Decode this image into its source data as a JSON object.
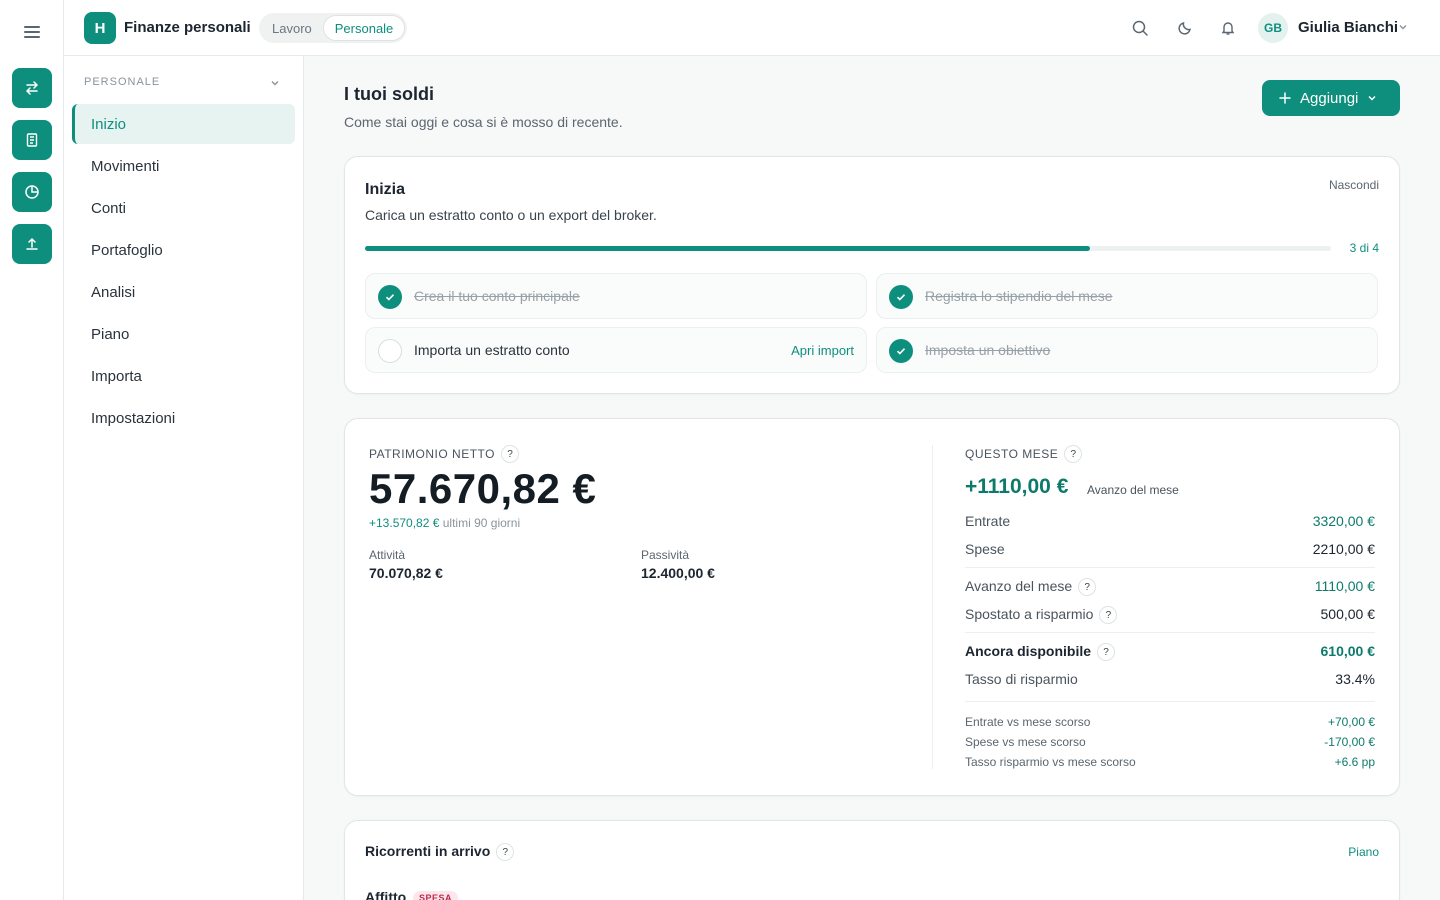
{
  "topbar": {
    "logo_letter": "H",
    "app_name": "Finanze personali",
    "segments": [
      "Lavoro",
      "Personale"
    ],
    "user_initials": "GB",
    "user_name": "Giulia Bianchi"
  },
  "sidebar": {
    "section": "PERSONALE",
    "items": [
      {
        "label": "Inizio",
        "active": true
      },
      {
        "label": "Movimenti"
      },
      {
        "label": "Conti"
      },
      {
        "label": "Portafoglio"
      },
      {
        "label": "Analisi"
      },
      {
        "label": "Piano"
      },
      {
        "label": "Importa"
      },
      {
        "label": "Impostazioni"
      }
    ]
  },
  "page": {
    "title": "I tuoi soldi",
    "subtitle": "Come stai oggi e cosa si è mosso di recente.",
    "add_label": "Aggiungi"
  },
  "onboarding": {
    "title": "Inizia",
    "description": "Carica un estratto conto o un export del broker.",
    "hide_label": "Nascondi",
    "progress_label": "3 di 4",
    "progress_fraction": 0.75,
    "tasks": [
      {
        "label": "Crea il tuo conto principale",
        "done": true
      },
      {
        "label": "Registra lo stipendio del mese",
        "done": true
      },
      {
        "label": "Importa un estratto conto",
        "done": false,
        "action": "Apri import"
      },
      {
        "label": "Imposta un obiettivo",
        "done": true
      }
    ]
  },
  "net_worth": {
    "caption": "PATRIMONIO NETTO",
    "help": "?",
    "value": "57.670,82 €",
    "delta": "+13.570,82 €",
    "delta_period": "ultimi 90 giorni",
    "assets_label": "Attività",
    "assets_value": "70.070,82 €",
    "liabilities_label": "Passività",
    "liabilities_value": "12.400,00 €"
  },
  "month": {
    "caption": "QUESTO MESE",
    "help": "?",
    "surplus": "+1110,00 €",
    "surplus_label": "Avanzo del mese",
    "income_label": "Entrate",
    "income_value": "3320,00 €",
    "expenses_label": "Spese",
    "expenses_value": "2210,00 €",
    "surplus_row_label": "Avanzo del mese",
    "surplus_row_value": "1110,00 €",
    "savings_moved_label": "Spostato a risparmio",
    "savings_moved_value": "500,00 €",
    "available_label": "Ancora disponibile",
    "available_value": "610,00 €",
    "savings_rate_label": "Tasso di risparmio",
    "savings_rate_value": "33.4%",
    "cmp_income_label": "Entrate vs mese scorso",
    "cmp_income_value": "+70,00 €",
    "cmp_expenses_label": "Spese vs mese scorso",
    "cmp_expenses_value": "-170,00 €",
    "cmp_rate_label": "Tasso risparmio vs mese scorso",
    "cmp_rate_value": "+6.6 pp"
  },
  "recurring": {
    "title": "Ricorrenti in arrivo",
    "help": "?",
    "link": "Piano",
    "first_item": "Affitto",
    "first_badge": "SPESA"
  },
  "colors": {
    "accent": "#0e8f7e",
    "positive": "#0e7a6c",
    "expense_badge": "#c1274a"
  }
}
